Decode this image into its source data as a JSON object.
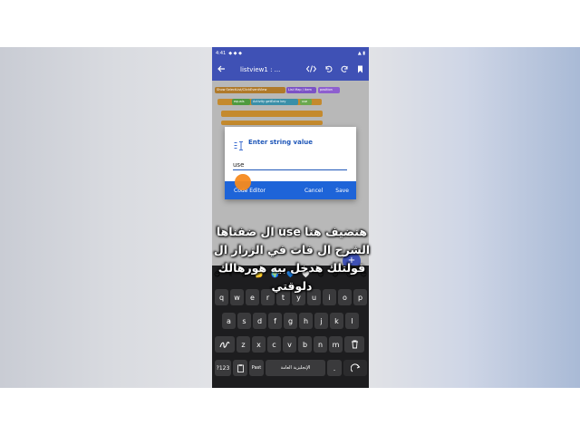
{
  "status_bar": {
    "time": "4:41",
    "indicators": "◆ ◆ ◆",
    "right": "▲ ▮"
  },
  "app_bar": {
    "title": "listview1 : ...",
    "icons": [
      "back-arrow-icon",
      "code-icon",
      "undo-icon",
      "redo-icon",
      "bookmark-icon"
    ],
    "accent": "#3f51b5"
  },
  "blocks": {
    "b1": "Show SelectList/ClickEventView",
    "b2": "List Map / item",
    "b3": "position",
    "b4": "equals",
    "b5": "Activity getExtra key",
    "b6": "use"
  },
  "dialog": {
    "title": "Enter string value",
    "input_value": "use",
    "code_editor": "Code Editor",
    "cancel": "Cancel",
    "save": "Save",
    "accent": "#1e64d8"
  },
  "keyboard": {
    "emojis": [
      "😋",
      "✌",
      "😘",
      "🤔",
      "🌍",
      "💙",
      "🤍",
      "😊",
      "😉",
      "😏",
      "😊"
    ],
    "row1": [
      "q",
      "w",
      "e",
      "r",
      "t",
      "y",
      "u",
      "i",
      "o",
      "p"
    ],
    "row2": [
      "a",
      "s",
      "d",
      "f",
      "g",
      "h",
      "j",
      "k",
      "l"
    ],
    "row3": [
      "z",
      "x",
      "c",
      "v",
      "b",
      "n",
      "m"
    ],
    "row4": {
      "num": "?123",
      "paste": "Past",
      "space": "الإنجليزية العامة",
      "period": "."
    }
  },
  "caption": {
    "line1": "هنضيف هنا use ال ضفناها",
    "line2": "الشرح ال فات في الزرار ال",
    "line3": "قولتلك هدخل بيه هورهالك",
    "line4": "دلوقتي"
  }
}
